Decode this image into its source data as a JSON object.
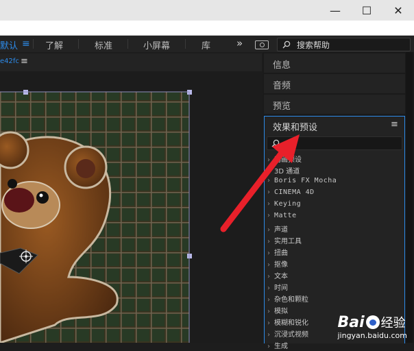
{
  "window": {
    "controls": [
      "—",
      "☐",
      "✕"
    ]
  },
  "workspace": {
    "tabs": [
      {
        "label": "默认",
        "active": true
      },
      {
        "label": "了解",
        "active": false
      },
      {
        "label": "标准",
        "active": false
      },
      {
        "label": "小屏幕",
        "active": false
      },
      {
        "label": "库",
        "active": false
      }
    ],
    "menu_icon": "≡",
    "overflow_icon": "»",
    "search_placeholder": "搜索帮助"
  },
  "composition": {
    "tab_label": "e42fc",
    "menu_icon": "≡"
  },
  "panels": {
    "collapsed": [
      "信息",
      "音频",
      "预览"
    ],
    "effects": {
      "title": "效果和预设",
      "menu_icon": "≡",
      "search_value": "",
      "items": [
        {
          "label": "动画预设",
          "mono": false
        },
        {
          "label": "3D 通道",
          "mono": false
        },
        {
          "label": "Boris FX Mocha",
          "mono": true
        },
        {
          "label": "CINEMA 4D",
          "mono": true
        },
        {
          "label": "Keying",
          "mono": true
        },
        {
          "label": "Matte",
          "mono": true
        },
        {
          "label": "声道",
          "mono": false
        },
        {
          "label": "实用工具",
          "mono": false
        },
        {
          "label": "扭曲",
          "mono": false
        },
        {
          "label": "抠像",
          "mono": false
        },
        {
          "label": "文本",
          "mono": false
        },
        {
          "label": "时间",
          "mono": false
        },
        {
          "label": "杂色和颗粒",
          "mono": false
        },
        {
          "label": "模拟",
          "mono": false
        },
        {
          "label": "模糊和锐化",
          "mono": false
        },
        {
          "label": "沉浸式视频",
          "mono": false
        },
        {
          "label": "生成",
          "mono": false
        }
      ]
    }
  },
  "watermark": {
    "brand": "Bai",
    "brand_suffix": "经验",
    "url": "jingyan.baidu.com"
  },
  "colors": {
    "accent": "#2d8ceb",
    "arrow": "#e8202a"
  }
}
